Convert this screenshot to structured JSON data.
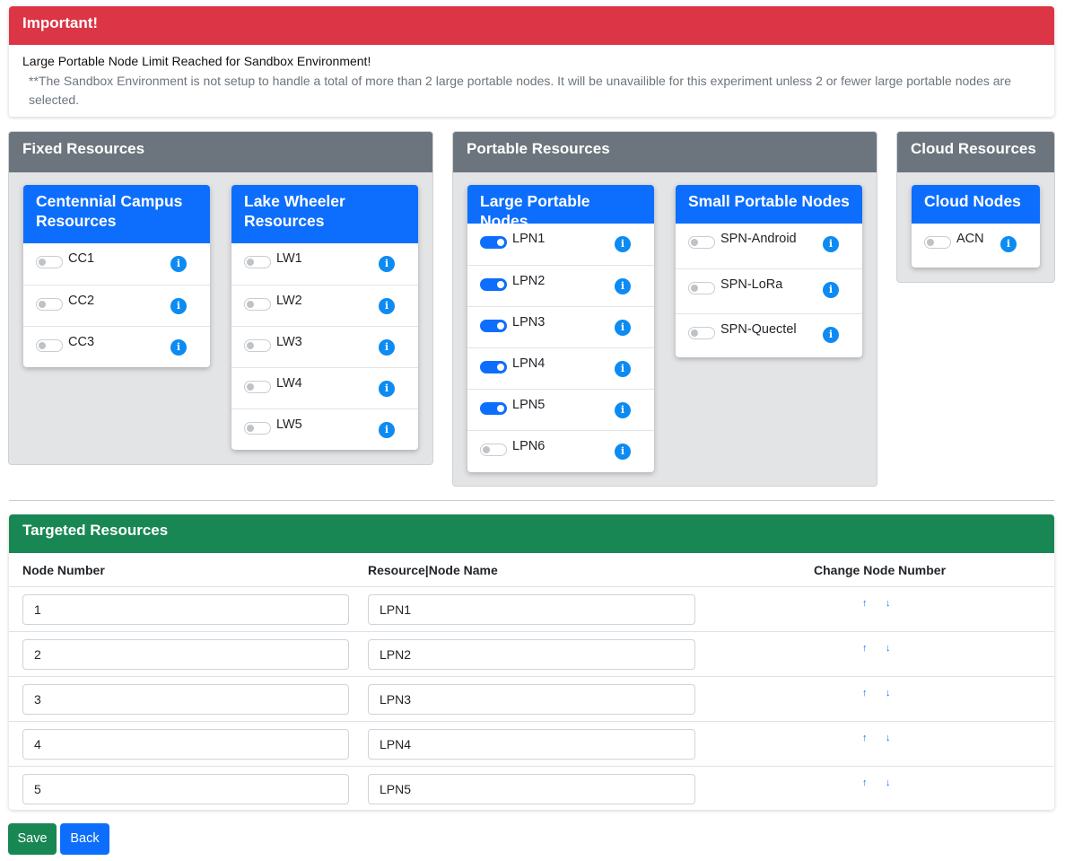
{
  "alert": {
    "title": "Important!",
    "message": "Large Portable Node Limit Reached for Sandbox Environment!",
    "note": "**The Sandbox Environment is not setup to handle a total of more than 2 large portable nodes. It will be unavailible for this experiment unless 2 or fewer large portable nodes are selected."
  },
  "fixed": {
    "title": "Fixed Resources",
    "centennial": {
      "title": "Centennial Campus Resources",
      "nodes": [
        {
          "name": "CC1",
          "on": false
        },
        {
          "name": "CC2",
          "on": false
        },
        {
          "name": "CC3",
          "on": false
        }
      ]
    },
    "lake": {
      "title": "Lake Wheeler Resources",
      "nodes": [
        {
          "name": "LW1",
          "on": false
        },
        {
          "name": "LW2",
          "on": false
        },
        {
          "name": "LW3",
          "on": false
        },
        {
          "name": "LW4",
          "on": false
        },
        {
          "name": "LW5",
          "on": false
        }
      ]
    }
  },
  "portable": {
    "title": "Portable Resources",
    "large": {
      "title": "Large Portable Nodes",
      "nodes": [
        {
          "name": "LPN1",
          "on": true
        },
        {
          "name": "LPN2",
          "on": true
        },
        {
          "name": "LPN3",
          "on": true
        },
        {
          "name": "LPN4",
          "on": true
        },
        {
          "name": "LPN5",
          "on": true
        },
        {
          "name": "LPN6",
          "on": false
        }
      ]
    },
    "small": {
      "title": "Small Portable Nodes",
      "nodes": [
        {
          "name": "SPN-Android",
          "on": false
        },
        {
          "name": "SPN-LoRa",
          "on": false
        },
        {
          "name": "SPN-Quectel",
          "on": false
        }
      ]
    }
  },
  "cloud": {
    "title": "Cloud Resources",
    "nodes_card": {
      "title": "Cloud Nodes",
      "nodes": [
        {
          "name": "ACN",
          "on": false
        }
      ]
    }
  },
  "info_glyph": "i",
  "targeted": {
    "title": "Targeted Resources",
    "col_node_number": "Node Number",
    "col_node_name": "Resource|Node Name",
    "col_change": "Change Node Number",
    "up_arrow": "↑",
    "down_arrow": "↓",
    "rows": [
      {
        "number": "1",
        "name": "LPN1"
      },
      {
        "number": "2",
        "name": "LPN2"
      },
      {
        "number": "3",
        "name": "LPN3"
      },
      {
        "number": "4",
        "name": "LPN4"
      },
      {
        "number": "5",
        "name": "LPN5"
      }
    ]
  },
  "buttons": {
    "save": "Save",
    "back": "Back"
  },
  "colors": {
    "danger": "#dc3545",
    "primary": "#0d6efd",
    "secondary": "#6c757d",
    "success": "#198754",
    "info": "#0d8bf2"
  }
}
